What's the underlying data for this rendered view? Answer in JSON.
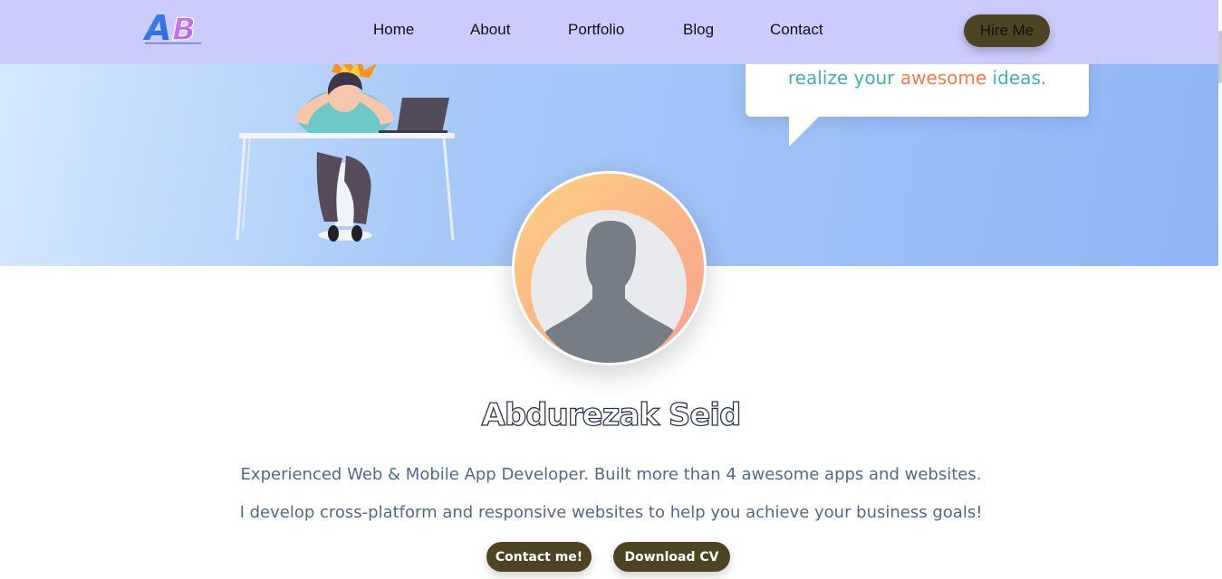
{
  "nav": {
    "logo_text": "AB",
    "links": [
      "Home",
      "About",
      "Portfolio",
      "Blog",
      "Contact"
    ],
    "hire_label": "Hire Me"
  },
  "hero": {
    "bubble": {
      "part1": "realize your ",
      "accent": "awesome",
      "part2": " ideas."
    }
  },
  "profile": {
    "name": "Abdurezak Seid",
    "line1": "Experienced Web & Mobile App Developer. Built more than 4 awesome apps and websites.",
    "line2": "I develop cross-platform and responsive websites to help you achieve your business goals!",
    "contact_label": "Contact me!",
    "cv_label": "Download CV"
  },
  "colors": {
    "navbar": "#cccbfd",
    "button": "#4e4423",
    "bubble_text": "#3fb1b2",
    "bubble_accent": "#f57a4c",
    "tagline": "#4f6a8d"
  }
}
